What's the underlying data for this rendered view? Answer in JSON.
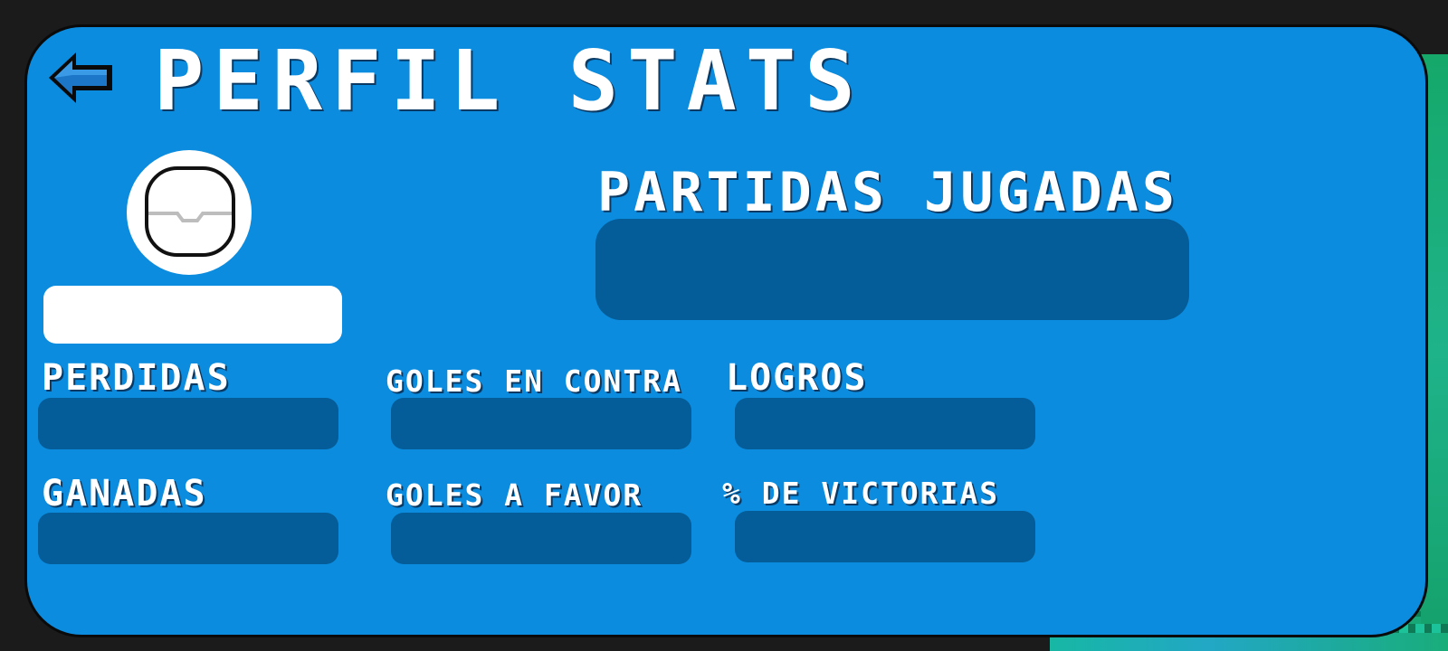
{
  "header": {
    "back_icon": "arrow-left-icon",
    "title": "PERFIL STATS"
  },
  "profile": {
    "avatar_icon": "player-avatar-icon",
    "name": ""
  },
  "main_stat": {
    "label": "PARTIDAS JUGADAS",
    "value": ""
  },
  "stats": {
    "perdidas": {
      "label": "PERDIDAS",
      "value": ""
    },
    "goles_en_contra": {
      "label": "GOLES EN CONTRA",
      "value": ""
    },
    "logros": {
      "label": "LOGROS",
      "value": ""
    },
    "ganadas": {
      "label": "GANADAS",
      "value": ""
    },
    "goles_a_favor": {
      "label": "GOLES A FAVOR",
      "value": ""
    },
    "victorias": {
      "label": "% DE VICTORIAS",
      "value": ""
    }
  },
  "colors": {
    "panel": "#0b8cdf",
    "value_box": "#045d98",
    "text": "#ffffff",
    "background": "#1b1b1b"
  }
}
